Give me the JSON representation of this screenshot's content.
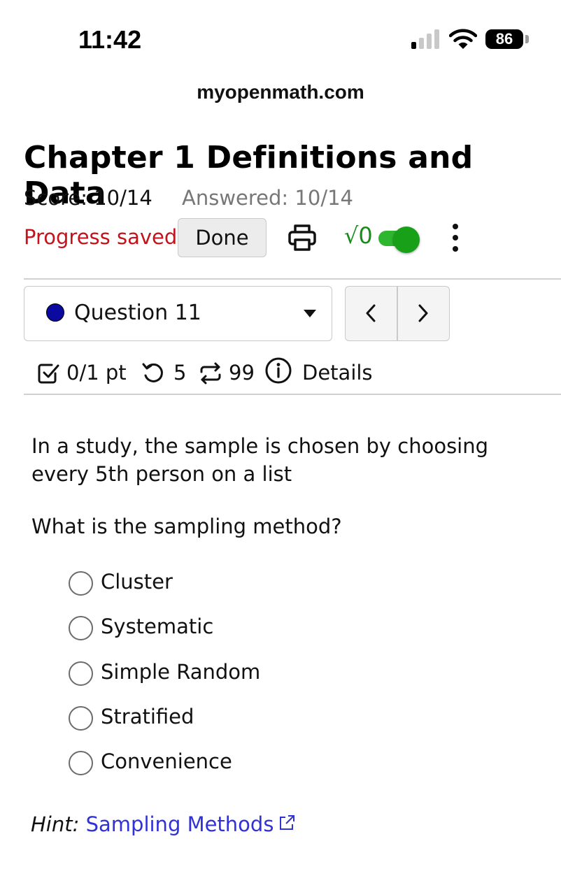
{
  "status_bar": {
    "time": "11:42",
    "battery": "86"
  },
  "browser": {
    "url": "myopenmath.com"
  },
  "header": {
    "title": "Chapter 1 Definitions and Data",
    "score": "Score: 10/14",
    "answered": "Answered: 10/14",
    "progress": "Progress saved",
    "done_label": "Done",
    "math_toggle_label": "√0",
    "math_toggle_on": true
  },
  "question_nav": {
    "selected": "Question 11",
    "prev_label": "‹",
    "next_label": "›"
  },
  "question_meta": {
    "points": "0/1 pt",
    "retries": "5",
    "attempts": "99",
    "details_label": "Details"
  },
  "question": {
    "text": "In a study, the sample is chosen by choosing every 5th person on a list",
    "prompt": "What is the sampling method?",
    "options": [
      "Cluster",
      "Systematic",
      "Simple Random",
      "Stratified",
      "Convenience"
    ]
  },
  "hint": {
    "lead": "Hint:",
    "link_text": "Sampling Methods"
  },
  "colors": {
    "progress_saved": "#c4131d",
    "link": "#3131d8",
    "toggle": "#2fb62f",
    "question_dot": "#0a0aa0"
  }
}
